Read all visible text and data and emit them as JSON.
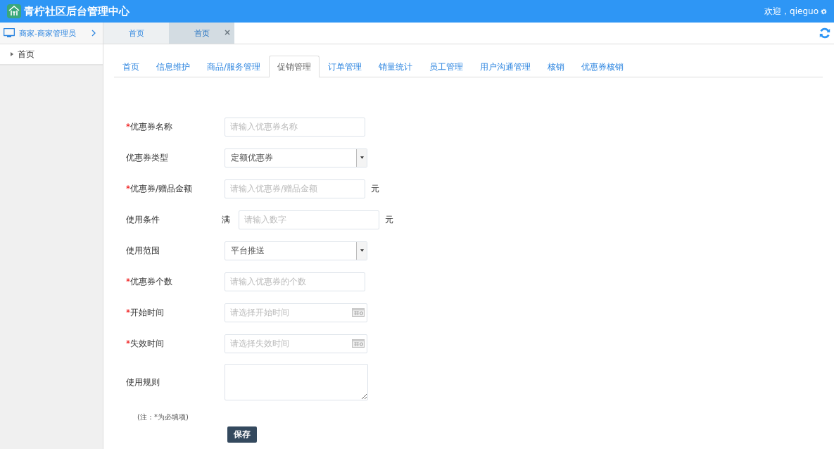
{
  "header": {
    "title": "青柠社区后台管理中心",
    "welcome": "欢迎，qieguo"
  },
  "sidebar": {
    "role": "商家-商家管理员",
    "items": [
      {
        "label": "首页",
        "selected": true
      }
    ]
  },
  "page_tabs": [
    {
      "label": "首页",
      "selected": false
    },
    {
      "label": "首页",
      "selected": true,
      "close": "×"
    }
  ],
  "nav_tabs": [
    {
      "label": "首页",
      "selected": false
    },
    {
      "label": "信息维护",
      "selected": false
    },
    {
      "label": "商品/服务管理",
      "selected": false
    },
    {
      "label": "促销管理",
      "selected": true
    },
    {
      "label": "订单管理",
      "selected": false
    },
    {
      "label": "销量统计",
      "selected": false
    },
    {
      "label": "员工管理",
      "selected": false
    },
    {
      "label": "用户沟通管理",
      "selected": false
    },
    {
      "label": "核销",
      "selected": false
    },
    {
      "label": "优惠券核销",
      "selected": false
    }
  ],
  "form": [
    {
      "kind": "text",
      "mark": "*",
      "label": "优惠券名称",
      "placeholder": "请输入优惠券名称"
    },
    {
      "kind": "select",
      "label": "优惠券类型",
      "value": "定额优惠券"
    },
    {
      "kind": "text",
      "mark": "*",
      "label": "优惠券/赠品金额",
      "placeholder": "请输入优惠券/赠品金额",
      "suffix": "元"
    },
    {
      "kind": "text",
      "label": "使用条件",
      "prefix": "满",
      "placeholder": "请输入数字",
      "suffix": "元"
    },
    {
      "kind": "select",
      "label": "使用范围",
      "value": "平台推送"
    },
    {
      "kind": "text",
      "mark": "*",
      "label": "优惠券个数",
      "placeholder": "请输入优惠券的个数"
    },
    {
      "kind": "date",
      "mark": "*",
      "label": "开始时间",
      "placeholder": "请选择开始时间"
    },
    {
      "kind": "date",
      "mark": "*",
      "label": "失效时间",
      "placeholder": "请选择失效时间"
    },
    {
      "kind": "textarea",
      "label": "使用规则"
    }
  ],
  "note": "(注：*为必填项)",
  "save_button": "保存"
}
